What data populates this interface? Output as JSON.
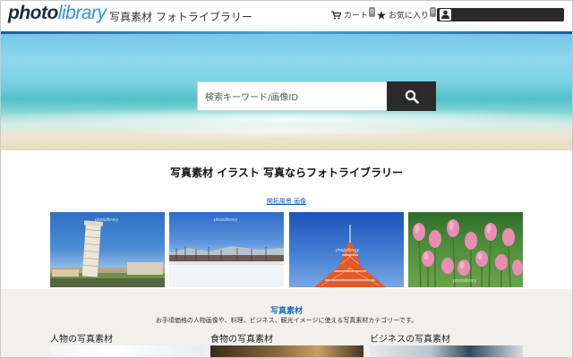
{
  "header": {
    "logo_part1": "photo",
    "logo_part2": "library",
    "tagline": "写真素材 フォトライブラリー",
    "cart_label": "カート",
    "cart_count": "0",
    "fav_label": "お気に入り",
    "fav_count": "0"
  },
  "search": {
    "placeholder": "検索キーワード/画像ID"
  },
  "main": {
    "title": "写真素材 イラスト 写真ならフォトライブラリー",
    "sub_link": "開拓風景 画像",
    "watermark": "photolibrary"
  },
  "photos": [
    {
      "subject": "leaning-tower-of-pisa"
    },
    {
      "subject": "snowy-field"
    },
    {
      "subject": "tokyo-tower"
    },
    {
      "subject": "pink-tulips"
    }
  ],
  "section": {
    "title": "写真素材",
    "description": "お手頃価格の人物画像や、料理、ビジネス、観光イメージに使える写真素材カテゴリーです。",
    "categories": [
      {
        "label": "人物の写真素材"
      },
      {
        "label": "食物の写真素材"
      },
      {
        "label": "ビジネスの写真素材"
      }
    ]
  },
  "icons": {
    "cart": "cart-icon",
    "fav": "star-icon",
    "user": "user-icon",
    "search": "search-icon"
  },
  "colors": {
    "accent_blue": "#1a6fd0",
    "logo_blue": "#3a8fd4",
    "dark_button": "#2b2b2b"
  }
}
